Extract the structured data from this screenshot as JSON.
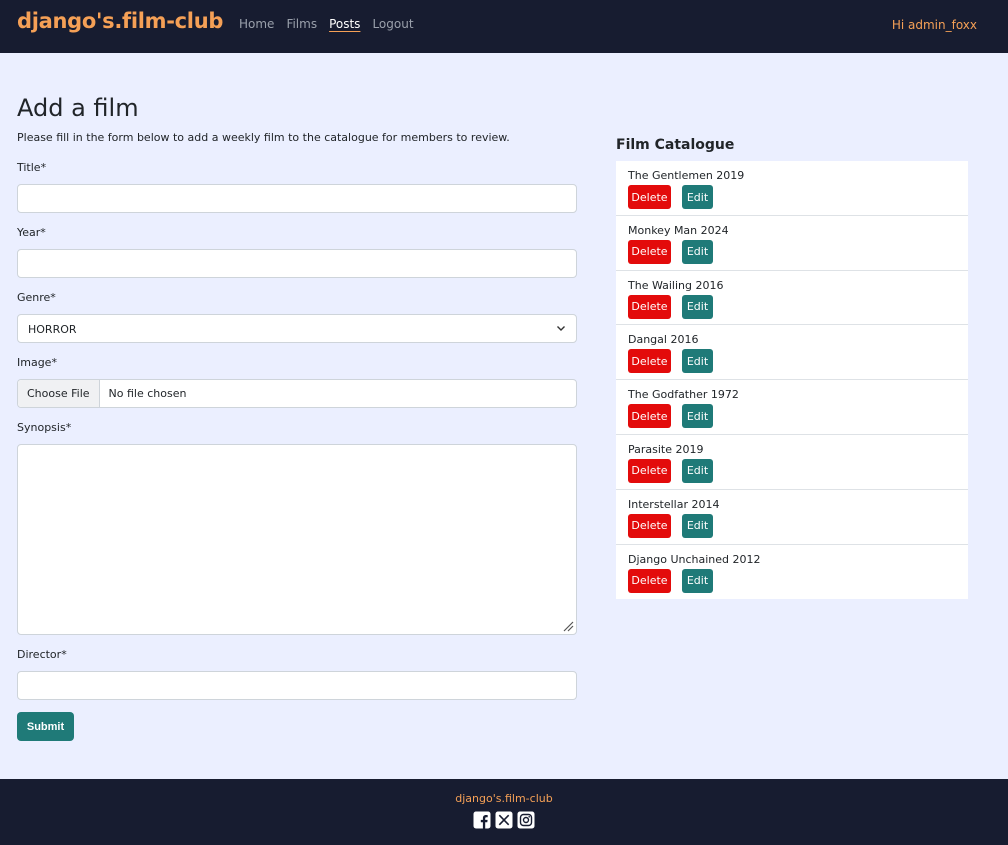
{
  "nav": {
    "brand": "django's.film-club",
    "links": [
      "Home",
      "Films",
      "Posts",
      "Logout"
    ],
    "greeting": "Hi admin_foxx"
  },
  "form": {
    "title": "Add a film",
    "intro": "Please fill in the form below to add a weekly film to the catalogue for members to review.",
    "labels": {
      "title": "Title*",
      "year": "Year*",
      "genre": "Genre*",
      "image": "Image*",
      "synopsis": "Synopsis*",
      "director": "Director*"
    },
    "genre_value": "HORROR",
    "file_button": "Choose File",
    "file_status": "No file chosen",
    "submit": "Submit"
  },
  "catalogue": {
    "title": "Film Catalogue",
    "delete_label": "Delete",
    "edit_label": "Edit",
    "films": [
      "The Gentlemen 2019",
      "Monkey Man 2024",
      "The Wailing 2016",
      "Dangal 2016",
      "The Godfather 1972",
      "Parasite 2019",
      "Interstellar 2014",
      "Django Unchained 2012"
    ]
  },
  "footer": {
    "brand": "django's.film-club",
    "social_icons": [
      "facebook-icon",
      "x-twitter-icon",
      "instagram-icon"
    ]
  },
  "colors": {
    "navbar_bg": "#171c30",
    "accent": "#f5a056",
    "page_bg": "#ebefff",
    "teal": "#1f7a78",
    "danger": "#e30b0b"
  }
}
